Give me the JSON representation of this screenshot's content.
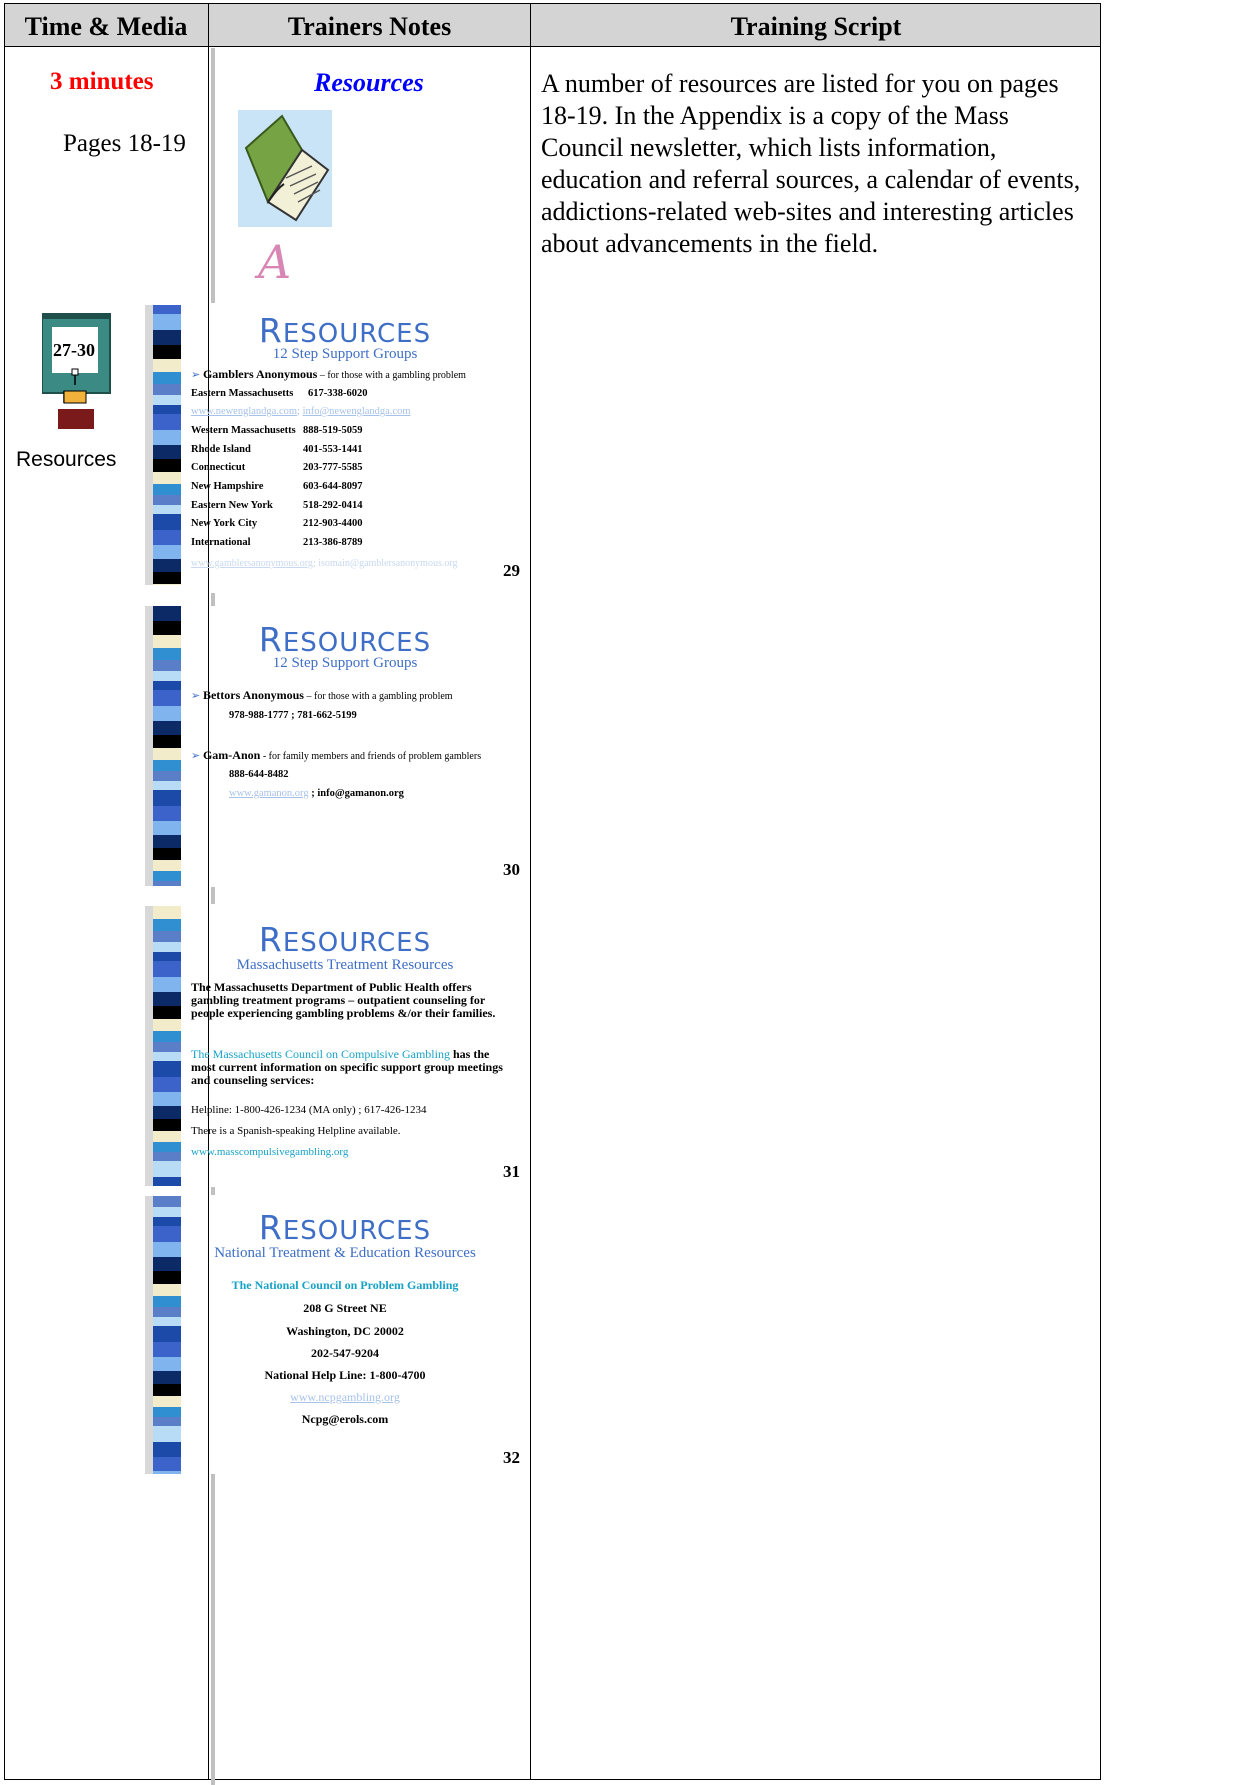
{
  "header": {
    "col1": "Time & Media",
    "col2": "Trainers Notes",
    "col3": "Training Script"
  },
  "row1": {
    "minutes": "3 minutes",
    "pages": "Pages 18-19",
    "notes_title": "Resources",
    "appendix_letter": "A",
    "script": "A number of resources are listed for you on pages 18-19. In the Appendix is a copy of the Mass Council newsletter, which lists information, education and referral sources, a calendar of events, addictions-related web-sites and interesting articles about advancements in the field."
  },
  "row2": {
    "slide_range": "27-30",
    "label": "Resources"
  },
  "slide_title_initial": "R",
  "slide_title_rest": "ESOURCES",
  "slides": [
    {
      "subtitle": "12 Step Support Groups",
      "heading": "Gamblers Anonymous",
      "heading_note": " – for those with a gambling problem",
      "first_region": "Eastern Massachusetts",
      "first_phone": "617-338-6020",
      "link1": "www.newenglandga.com",
      "link1_sep": "; ",
      "link2": "info@newenglandga.com",
      "regions": [
        {
          "name": "Western Massachusetts",
          "phone": "888-519-5059"
        },
        {
          "name": "Rhode Island",
          "phone": "401-553-1441"
        },
        {
          "name": "Connecticut",
          "phone": "203-777-5585"
        },
        {
          "name": "New Hampshire",
          "phone": "603-644-8097"
        },
        {
          "name": "Eastern New York",
          "phone": "518-292-0414"
        },
        {
          "name": "New York City",
          "phone": "212-903-4400"
        },
        {
          "name": "International",
          "phone": "213-386-8789"
        }
      ],
      "footer_link": "www.gamblersanonymous.org",
      "footer_sep": "; ",
      "footer_email": "isomain@gamblersanonymous.org",
      "number": "29"
    },
    {
      "subtitle": "12 Step Support Groups",
      "item1_title": "Bettors Anonymous",
      "item1_note": " – for those with a gambling problem",
      "item1_phones": "978-988-1777 ; 781-662-5199",
      "item2_title": "Gam-Anon",
      "item2_note": " - for family members and friends of problem gamblers",
      "item2_phone": "888-644-8482",
      "item2_link": "www.gamanon.org",
      "item2_email": " ; info@gamanon.org",
      "number": "30"
    },
    {
      "subtitle": "Massachusetts Treatment Resources",
      "para1": "The Massachusetts Department of Public Health offers gambling treatment programs – outpatient counseling for people experiencing gambling problems &/or their families.",
      "para2_teal": "The Massachusetts Council on Compulsive Gambling",
      "para2_rest": " has the most current information on specific support group meetings and counseling services:",
      "helpline": "Helpline: 1-800-426-1234 (MA only) ; 617-426-1234",
      "spanish": "There is a Spanish-speaking Helpline available.",
      "url": "www.masscompulsivegambling.org",
      "number": "31"
    },
    {
      "subtitle": "National Treatment & Education Resources",
      "org": "The National Council on Problem Gambling",
      "street": "208 G Street NE",
      "city": "Washington, DC 20002",
      "phone": "202-547-9204",
      "helpline": "National Help Line: 1-800-4700",
      "url": "www.ncpgambling.org",
      "email": "Ncpg@erols.com",
      "number": "32"
    }
  ]
}
